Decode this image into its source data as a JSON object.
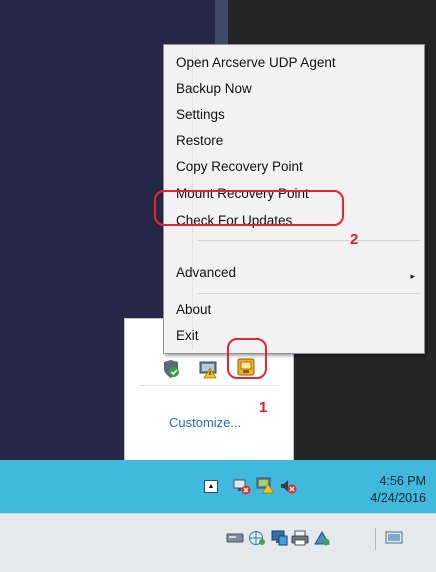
{
  "context_menu": {
    "items": [
      {
        "label": "Open Arcserve UDP Agent"
      },
      {
        "label": "Backup Now"
      },
      {
        "label": "Settings"
      },
      {
        "label": "Restore"
      },
      {
        "label": "Copy Recovery Point"
      },
      {
        "label": "Mount Recovery Point"
      },
      {
        "label": "Check For Updates"
      },
      {
        "label": "Advanced"
      },
      {
        "label": "About"
      },
      {
        "label": "Exit"
      }
    ],
    "submenu_arrow": "▸"
  },
  "overflow_panel": {
    "icons": [
      "shield-check-icon",
      "warning-monitor-icon",
      "arcserve-agent-icon"
    ],
    "customize_label": "Customize..."
  },
  "annotations": {
    "callout_1": "1",
    "callout_2": "2",
    "color": "#e0282f"
  },
  "taskbar": {
    "tray_overflow_glyph": "▲",
    "icons": [
      "network-error-icon",
      "monitor-warning-icon",
      "volume-muted-icon"
    ],
    "time": "4:56 PM",
    "date": "4/24/2016",
    "color": "#41b9dd"
  },
  "bottom_strip": {
    "icons": [
      "device-icon",
      "network-icon",
      "monitor-icon",
      "printer-icon",
      "alert-icon",
      "display-icon"
    ]
  }
}
